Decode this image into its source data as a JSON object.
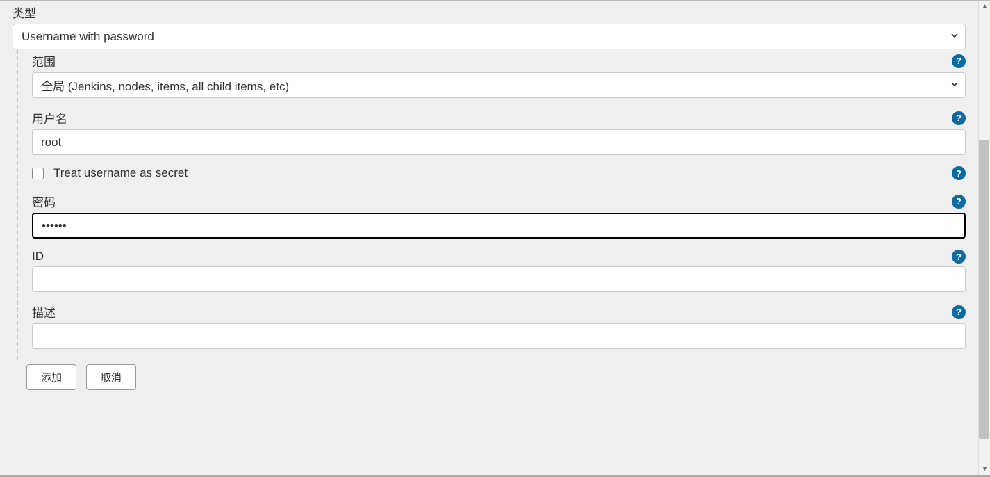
{
  "type": {
    "label": "类型",
    "value": "Username with password"
  },
  "scope": {
    "label": "范围",
    "value": "全局 (Jenkins, nodes, items, all child items, etc)"
  },
  "username": {
    "label": "用户名",
    "value": "root"
  },
  "treat_secret": {
    "label": "Treat username as secret",
    "checked": false
  },
  "password": {
    "label": "密码",
    "value": "••••••"
  },
  "id": {
    "label": "ID",
    "value": ""
  },
  "description": {
    "label": "描述",
    "value": ""
  },
  "buttons": {
    "add": "添加",
    "cancel": "取消"
  },
  "help_glyph": "?"
}
